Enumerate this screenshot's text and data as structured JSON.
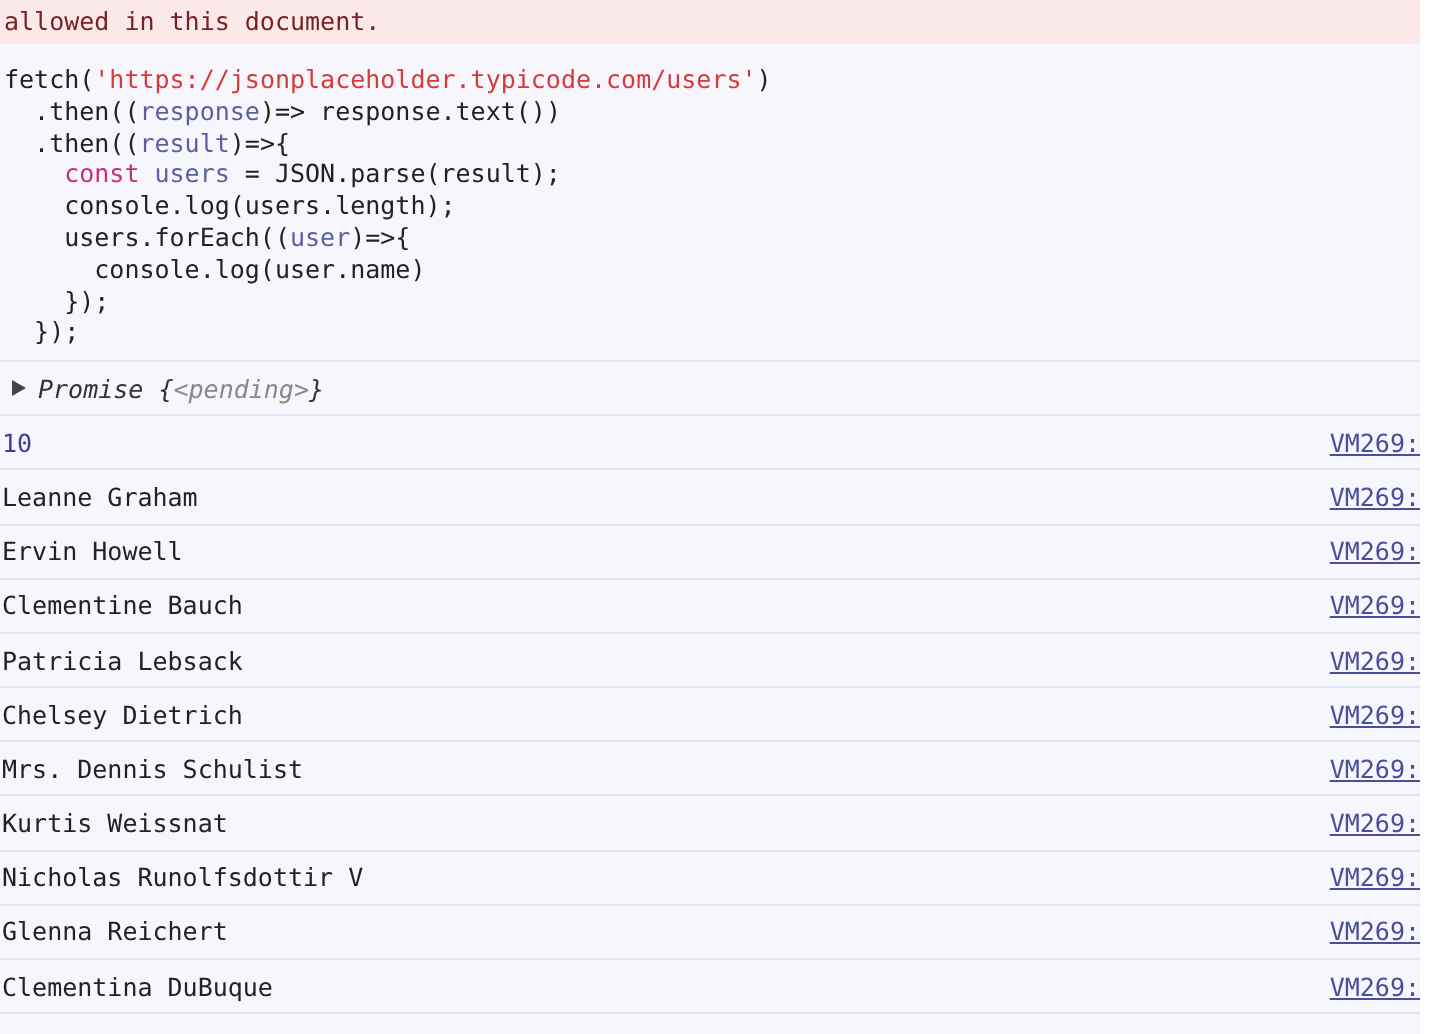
{
  "error_message": {
    "text": "allowed in this document."
  },
  "input": {
    "lines": [
      [
        {
          "kind": "plain",
          "text": "fetch("
        },
        {
          "kind": "string",
          "text": "'https://jsonplaceholder.typicode.com/users'"
        },
        {
          "kind": "plain",
          "text": ")"
        }
      ],
      [
        {
          "kind": "plain",
          "text": "  .then(("
        },
        {
          "kind": "param",
          "text": "response"
        },
        {
          "kind": "plain",
          "text": ")=> response.text())"
        }
      ],
      [
        {
          "kind": "plain",
          "text": "  .then(("
        },
        {
          "kind": "param",
          "text": "result"
        },
        {
          "kind": "plain",
          "text": ")=>{"
        }
      ],
      [
        {
          "kind": "keyword",
          "text": "    const"
        },
        {
          "kind": "param",
          "text": " users"
        },
        {
          "kind": "plain",
          "text": " = JSON.parse(result);"
        }
      ],
      [
        {
          "kind": "plain",
          "text": "    console.log(users.length);"
        }
      ],
      [
        {
          "kind": "plain",
          "text": "    users.forEach(("
        },
        {
          "kind": "param",
          "text": "user"
        },
        {
          "kind": "plain",
          "text": ")=>{"
        }
      ],
      [
        {
          "kind": "plain",
          "text": "      console.log(user.name)"
        }
      ],
      [
        {
          "kind": "plain",
          "text": "    });"
        }
      ],
      [
        {
          "kind": "plain",
          "text": "  });"
        }
      ]
    ]
  },
  "result": {
    "expanded": false,
    "label": "Promise",
    "open_brace": "{",
    "state": "<pending>",
    "close_brace": "}"
  },
  "logs": [
    {
      "kind": "number",
      "text": "10",
      "source": "VM269:"
    },
    {
      "kind": "string",
      "text": "Leanne Graham",
      "source": "VM269:"
    },
    {
      "kind": "string",
      "text": "Ervin Howell",
      "source": "VM269:"
    },
    {
      "kind": "string",
      "text": "Clementine Bauch",
      "source": "VM269:"
    },
    {
      "kind": "string",
      "text": "Patricia Lebsack",
      "source": "VM269:"
    },
    {
      "kind": "string",
      "text": "Chelsey Dietrich",
      "source": "VM269:"
    },
    {
      "kind": "string",
      "text": "Mrs. Dennis Schulist",
      "source": "VM269:"
    },
    {
      "kind": "string",
      "text": "Kurtis Weissnat",
      "source": "VM269:"
    },
    {
      "kind": "string",
      "text": "Nicholas Runolfsdottir V",
      "source": "VM269:"
    },
    {
      "kind": "string",
      "text": "Glenna Reichert",
      "source": "VM269:"
    },
    {
      "kind": "string",
      "text": "Clementina DuBuque",
      "source": "VM269:"
    }
  ]
}
